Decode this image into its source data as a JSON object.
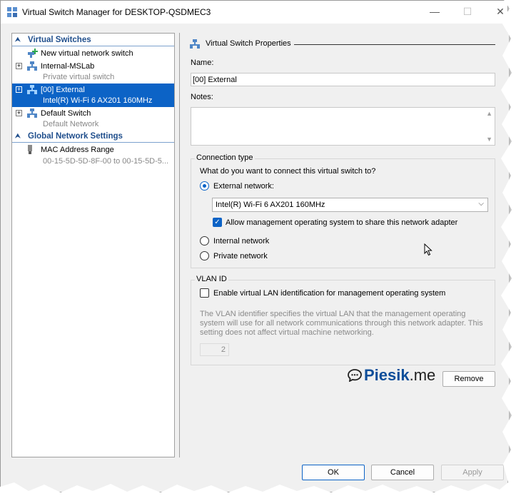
{
  "window": {
    "title": "Virtual Switch Manager for DESKTOP-QSDMEC3",
    "controls": {
      "minimize": "—",
      "maximize": "☐",
      "close": "✕"
    }
  },
  "left_pane": {
    "virtual_switches_header": "Virtual Switches",
    "items": [
      {
        "label": "New virtual network switch",
        "sublabel": ""
      },
      {
        "label": "Internal-MSLab",
        "sublabel": "Private virtual switch"
      },
      {
        "label": "[00] External",
        "sublabel": "Intel(R) Wi-Fi 6 AX201 160MHz"
      },
      {
        "label": "Default Switch",
        "sublabel": "Default Network"
      }
    ],
    "global_header": "Global Network Settings",
    "mac": {
      "label": "MAC Address Range",
      "sublabel": "00-15-5D-5D-8F-00 to 00-15-5D-5..."
    }
  },
  "right_pane": {
    "section_title": "Virtual Switch Properties",
    "name_label": "Name:",
    "name_value": "[00] External",
    "notes_label": "Notes:",
    "notes_value": "",
    "connection_type": {
      "legend": "Connection type",
      "question": "What do you want to connect this virtual switch to?",
      "external_label": "External network:",
      "adapter_selected": "Intel(R) Wi-Fi 6 AX201 160MHz",
      "allow_mgmt_label": "Allow management operating system to share this network adapter",
      "internal_label": "Internal network",
      "private_label": "Private network"
    },
    "vlan": {
      "legend": "VLAN ID",
      "enable_label": "Enable virtual LAN identification for management operating system",
      "description": "The VLAN identifier specifies the virtual LAN that the management operating system will use for all network communications through this network adapter. This setting does not affect virtual machine networking.",
      "value": "2"
    },
    "remove_button": "Remove"
  },
  "footer": {
    "ok": "OK",
    "cancel": "Cancel",
    "apply": "Apply"
  },
  "watermark": {
    "brand": "Piesik",
    "tld": ".me"
  },
  "colors": {
    "selection": "#0c63c6",
    "header_text": "#1f4e8c",
    "brand": "#0e4e9a"
  }
}
